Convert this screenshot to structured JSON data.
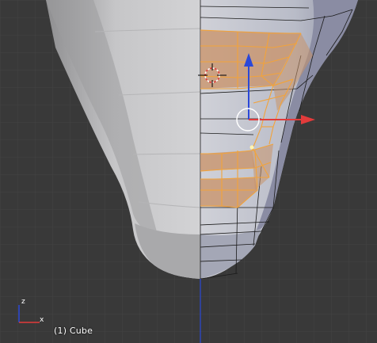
{
  "viewport": {
    "object_label": "(1) Cube",
    "background_color": "#393939",
    "grid_color": "#444444",
    "selection_color": "#f2a33a",
    "selected_face_color": "#c9946a",
    "mesh_color": "#b9bcc8",
    "axis_colors": {
      "x": "#e23b3b",
      "y": "#7aa33b",
      "z": "#2b48d8"
    },
    "gizmo_axis_labels": {
      "x": "x",
      "z": "z"
    }
  }
}
